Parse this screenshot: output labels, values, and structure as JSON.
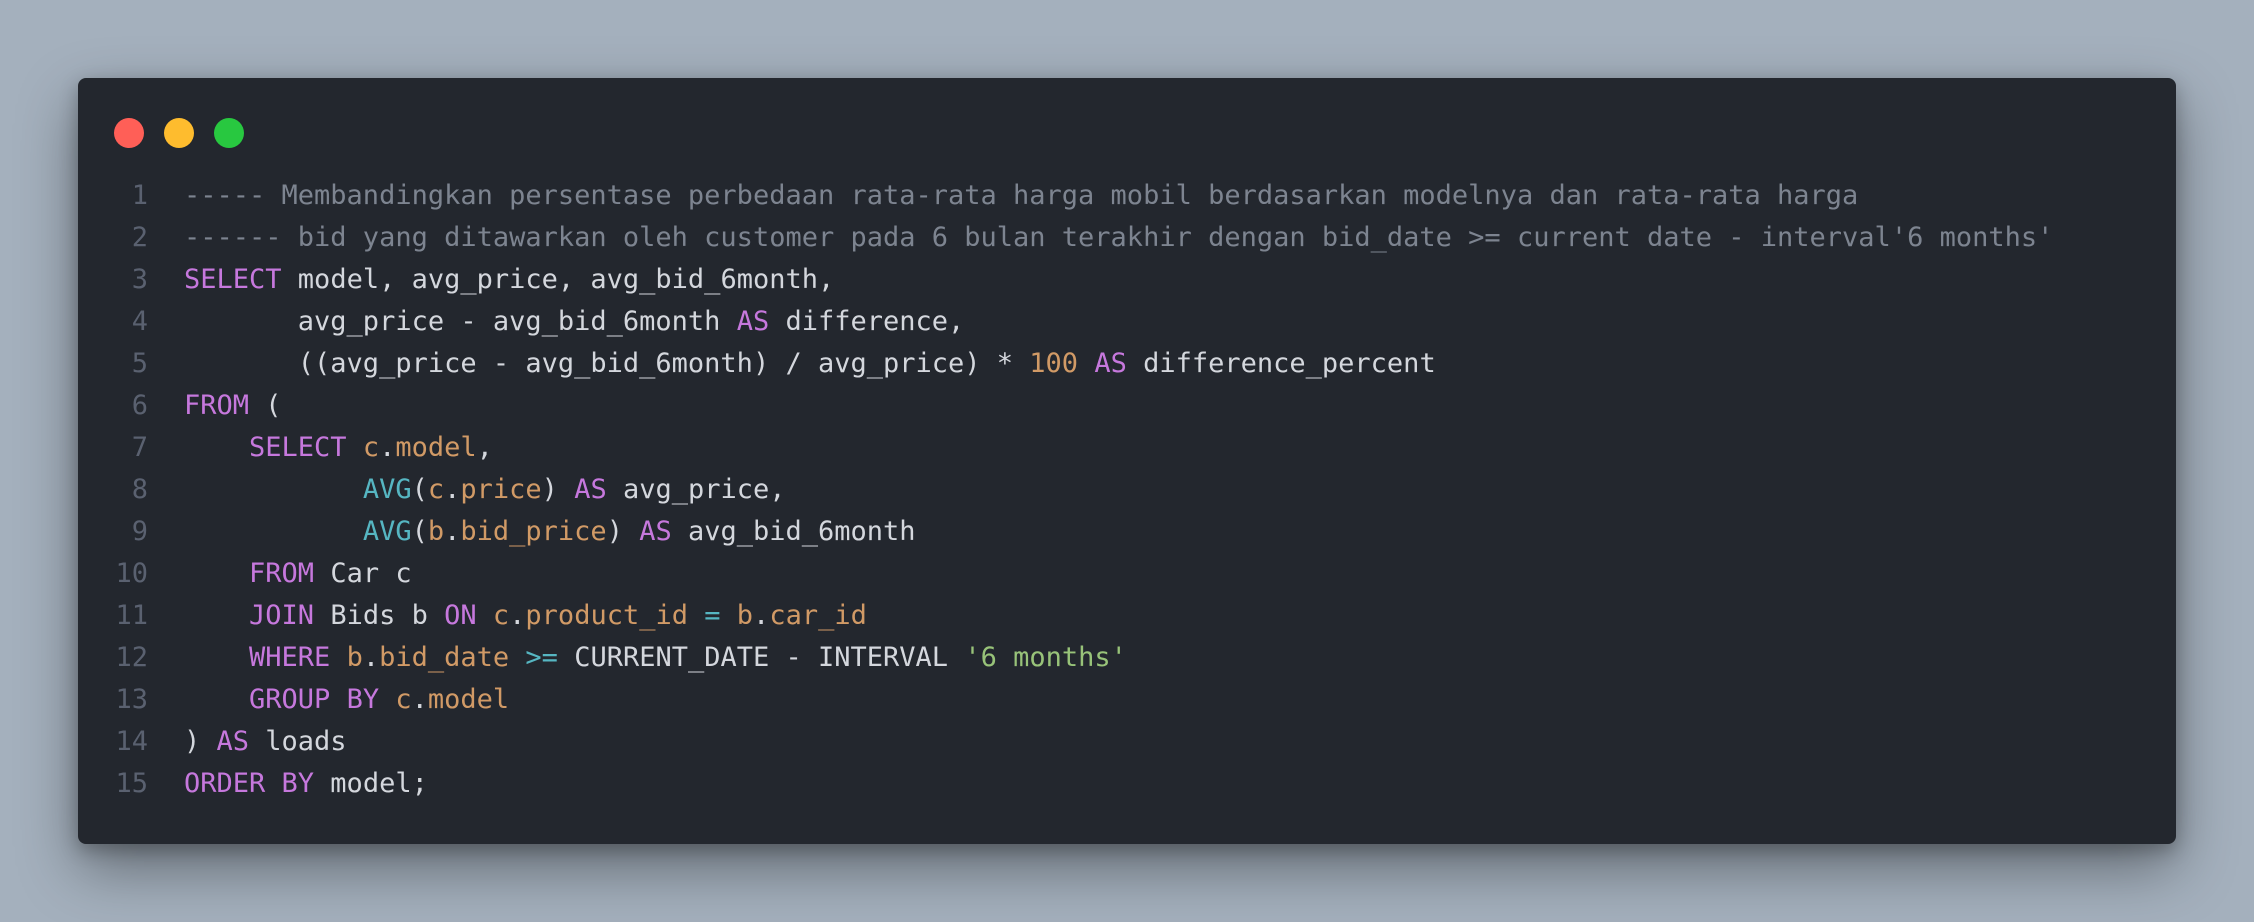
{
  "window": {
    "buttons": [
      {
        "name": "close",
        "color": "#ff5f57"
      },
      {
        "name": "minimize",
        "color": "#febc2e"
      },
      {
        "name": "zoom",
        "color": "#28c840"
      }
    ]
  },
  "code": {
    "lines": [
      {
        "n": "1",
        "tokens": [
          [
            "cm",
            "----- Membandingkan persentase perbedaan rata-rata harga mobil berdasarkan modelnya dan rata-rata harga"
          ]
        ]
      },
      {
        "n": "2",
        "tokens": [
          [
            "cm",
            "------ bid yang ditawarkan oleh customer pada 6 bulan terakhir dengan bid_date >= current date - interval'6 months'"
          ]
        ]
      },
      {
        "n": "3",
        "tokens": [
          [
            "kw",
            "SELECT"
          ],
          [
            "tx",
            " model, avg_price, avg_bid_6month,"
          ]
        ]
      },
      {
        "n": "4",
        "tokens": [
          [
            "tx",
            "       avg_price - avg_bid_6month "
          ],
          [
            "kw",
            "AS"
          ],
          [
            "tx",
            " difference,"
          ]
        ]
      },
      {
        "n": "5",
        "tokens": [
          [
            "tx",
            "       ((avg_price - avg_bid_6month) / avg_price) * "
          ],
          [
            "num",
            "100"
          ],
          [
            "tx",
            " "
          ],
          [
            "kw",
            "AS"
          ],
          [
            "tx",
            " difference_percent"
          ]
        ]
      },
      {
        "n": "6",
        "tokens": [
          [
            "kw",
            "FROM"
          ],
          [
            "tx",
            " ("
          ]
        ]
      },
      {
        "n": "7",
        "tokens": [
          [
            "tx",
            "    "
          ],
          [
            "kw",
            "SELECT"
          ],
          [
            "tx",
            " "
          ],
          [
            "id",
            "c"
          ],
          [
            "tx",
            "."
          ],
          [
            "id",
            "model"
          ],
          [
            "tx",
            ","
          ]
        ]
      },
      {
        "n": "8",
        "tokens": [
          [
            "tx",
            "           "
          ],
          [
            "fn",
            "AVG"
          ],
          [
            "tx",
            "("
          ],
          [
            "id",
            "c"
          ],
          [
            "tx",
            "."
          ],
          [
            "id",
            "price"
          ],
          [
            "tx",
            ") "
          ],
          [
            "kw",
            "AS"
          ],
          [
            "tx",
            " avg_price,"
          ]
        ]
      },
      {
        "n": "9",
        "tokens": [
          [
            "tx",
            "           "
          ],
          [
            "fn",
            "AVG"
          ],
          [
            "tx",
            "("
          ],
          [
            "id",
            "b"
          ],
          [
            "tx",
            "."
          ],
          [
            "id",
            "bid_price"
          ],
          [
            "tx",
            ") "
          ],
          [
            "kw",
            "AS"
          ],
          [
            "tx",
            " avg_bid_6month"
          ]
        ]
      },
      {
        "n": "10",
        "tokens": [
          [
            "tx",
            "    "
          ],
          [
            "kw",
            "FROM"
          ],
          [
            "tx",
            " Car c"
          ]
        ]
      },
      {
        "n": "11",
        "tokens": [
          [
            "tx",
            "    "
          ],
          [
            "kw",
            "JOIN"
          ],
          [
            "tx",
            " Bids b "
          ],
          [
            "kw",
            "ON"
          ],
          [
            "tx",
            " "
          ],
          [
            "id",
            "c"
          ],
          [
            "tx",
            "."
          ],
          [
            "id",
            "product_id"
          ],
          [
            "tx",
            " "
          ],
          [
            "op",
            "="
          ],
          [
            "tx",
            " "
          ],
          [
            "id",
            "b"
          ],
          [
            "tx",
            "."
          ],
          [
            "id",
            "car_id"
          ]
        ]
      },
      {
        "n": "12",
        "tokens": [
          [
            "tx",
            "    "
          ],
          [
            "kw",
            "WHERE"
          ],
          [
            "tx",
            " "
          ],
          [
            "id",
            "b"
          ],
          [
            "tx",
            "."
          ],
          [
            "id",
            "bid_date"
          ],
          [
            "tx",
            " "
          ],
          [
            "op",
            ">="
          ],
          [
            "tx",
            " CURRENT_DATE - INTERVAL "
          ],
          [
            "str",
            "'6 months'"
          ]
        ]
      },
      {
        "n": "13",
        "tokens": [
          [
            "tx",
            "    "
          ],
          [
            "kw",
            "GROUP BY"
          ],
          [
            "tx",
            " "
          ],
          [
            "id",
            "c"
          ],
          [
            "tx",
            "."
          ],
          [
            "id",
            "model"
          ]
        ]
      },
      {
        "n": "14",
        "tokens": [
          [
            "tx",
            ") "
          ],
          [
            "kw",
            "AS"
          ],
          [
            "tx",
            " loads"
          ]
        ]
      },
      {
        "n": "15",
        "tokens": [
          [
            "kw",
            "ORDER BY"
          ],
          [
            "tx",
            " model;"
          ]
        ]
      }
    ]
  }
}
